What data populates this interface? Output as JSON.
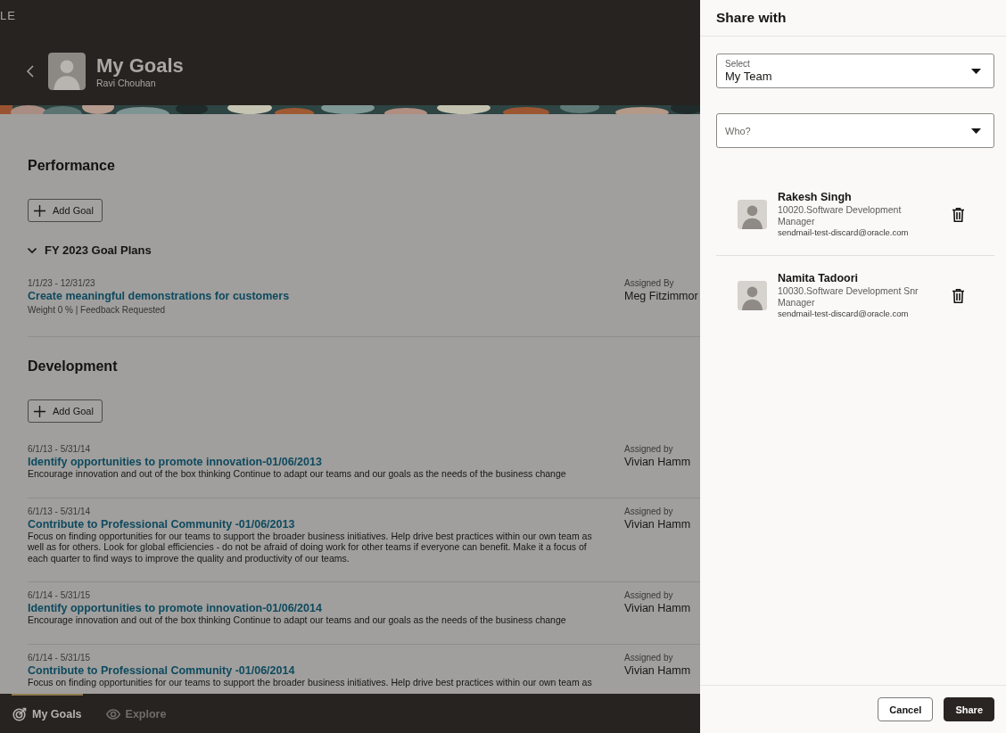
{
  "header": {
    "logo_text": "LE",
    "title": "My Goals",
    "subtitle": "Ravi Chouhan"
  },
  "sections": [
    {
      "heading": "Performance",
      "add_button": "Add Goal",
      "group": {
        "label": "FY 2023 Goal Plans",
        "expanded": true,
        "goals": [
          {
            "dates": "1/1/23 - 12/31/23",
            "title": "Create meaningful demonstrations for customers",
            "meta": "Weight 0 % | Feedback Requested",
            "assigned_label": "Assigned By",
            "assigned_to": "Meg Fitzimmor"
          }
        ]
      }
    },
    {
      "heading": "Development",
      "add_button": "Add Goal",
      "goals": [
        {
          "dates": "6/1/13 - 5/31/14",
          "title": "Identify opportunities to promote innovation-01/06/2013",
          "description": "Encourage innovation and out of the box thinking Continue to adapt our teams and our goals as the needs of the business change",
          "assigned_label": "Assigned by",
          "assigned_to": "Vivian Hamm"
        },
        {
          "dates": "6/1/13 - 5/31/14",
          "title": "Contribute to Professional Community -01/06/2013",
          "description": "Focus on finding opportunities for our teams to support the broader business initiatives. Help drive best practices within our own team as well as for others. Look for global efficiencies - do not be afraid of doing work for other teams if everyone can benefit. Make it a focus of each quarter to find ways to improve the quality and productivity of our teams.",
          "assigned_label": "Assigned by",
          "assigned_to": "Vivian Hamm"
        },
        {
          "dates": "6/1/14 - 5/31/15",
          "title": "Identify opportunities to promote innovation-01/06/2014",
          "description": "Encourage innovation and out of the box thinking Continue to adapt our teams and our goals as the needs of the business change",
          "assigned_label": "Assigned by",
          "assigned_to": "Vivian Hamm"
        },
        {
          "dates": "6/1/14 - 5/31/15",
          "title": "Contribute to Professional Community -01/06/2014",
          "description": "Focus on finding opportunities for our teams to support the broader business initiatives. Help drive best practices within our own team as",
          "assigned_label": "Assigned by",
          "assigned_to": "Vivian Hamm"
        }
      ]
    }
  ],
  "nav": {
    "tabs": [
      {
        "label": "My Goals",
        "selected": true
      },
      {
        "label": "Explore",
        "selected": false
      }
    ]
  },
  "share_panel": {
    "title": "Share with",
    "select_field": {
      "label": "Select",
      "value": "My Team"
    },
    "who_field": {
      "placeholder": "Who?"
    },
    "people": [
      {
        "name": "Rakesh Singh",
        "job": "10020.Software Development Manager",
        "email": "sendmail-test-discard@oracle.com"
      },
      {
        "name": "Namita Tadoori",
        "job": "10030.Software Development Snr Manager",
        "email": "sendmail-test-discard@oracle.com"
      }
    ],
    "buttons": [
      {
        "label": "Cancel",
        "kind": "secondary"
      },
      {
        "label": "Share",
        "kind": "primary"
      }
    ]
  }
}
